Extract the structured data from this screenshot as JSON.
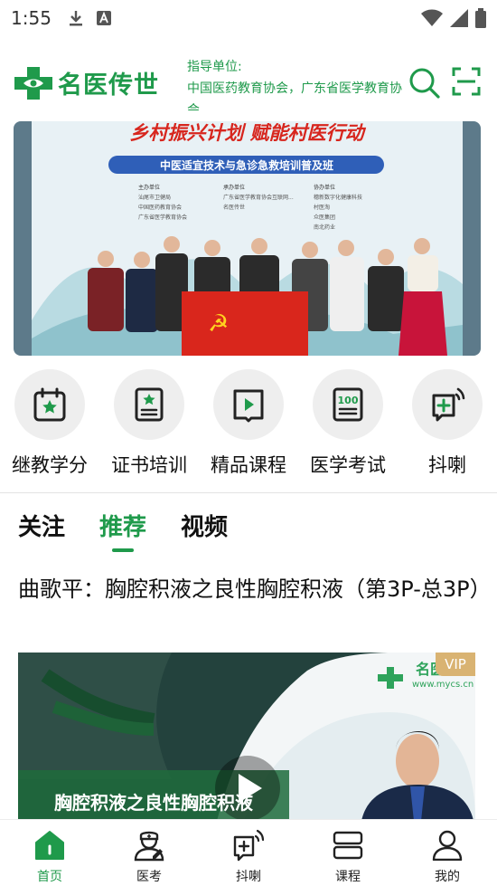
{
  "status_bar": {
    "time": "1:55"
  },
  "header": {
    "logo_text": "名医传世",
    "guide_label": "指导单位:",
    "guide_text": "中国医药教育协会，广东省医学教育协会"
  },
  "banner": {
    "title": "乡村振兴计划 赋能村医行动",
    "subtitle": "中医适宜技术与急诊急救培训普及班",
    "columns": [
      {
        "heading": "主办单位",
        "items": [
          "汕尾市卫健局",
          "中国医药教育协会",
          "广东省医学教育协会"
        ]
      },
      {
        "heading": "承办单位",
        "items": [
          "广东省医学教育协会互联网...",
          "名医传世"
        ]
      },
      {
        "heading": "协办单位",
        "items": [
          "穗新数字化健康科技",
          "村医淘",
          "众医集团",
          "南北药业"
        ]
      }
    ]
  },
  "quick_entries": [
    {
      "label": "继教学分",
      "icon": "calendar-star-icon"
    },
    {
      "label": "证书培训",
      "icon": "certificate-icon"
    },
    {
      "label": "精品课程",
      "icon": "play-book-icon"
    },
    {
      "label": "医学考试",
      "icon": "exam-100-icon"
    },
    {
      "label": "抖喇",
      "icon": "broadcast-plus-icon"
    }
  ],
  "tabs": [
    {
      "label": "关注",
      "active": false
    },
    {
      "label": "推荐",
      "active": true
    },
    {
      "label": "视频",
      "active": false
    }
  ],
  "article": {
    "title": "曲歌平：胸腔积液之良性胸腔积液（第3P-总3P）",
    "video_badge": "VIP",
    "video_caption": "胸腔积液之良性胸腔积液",
    "video_watermark": "www.mycs.cn"
  },
  "bottom_nav": [
    {
      "label": "首页",
      "active": true
    },
    {
      "label": "医考",
      "active": false
    },
    {
      "label": "抖喇",
      "active": false
    },
    {
      "label": "课程",
      "active": false
    },
    {
      "label": "我的",
      "active": false
    }
  ],
  "colors": {
    "brand": "#1f9a4b",
    "vip": "#d9b372"
  }
}
